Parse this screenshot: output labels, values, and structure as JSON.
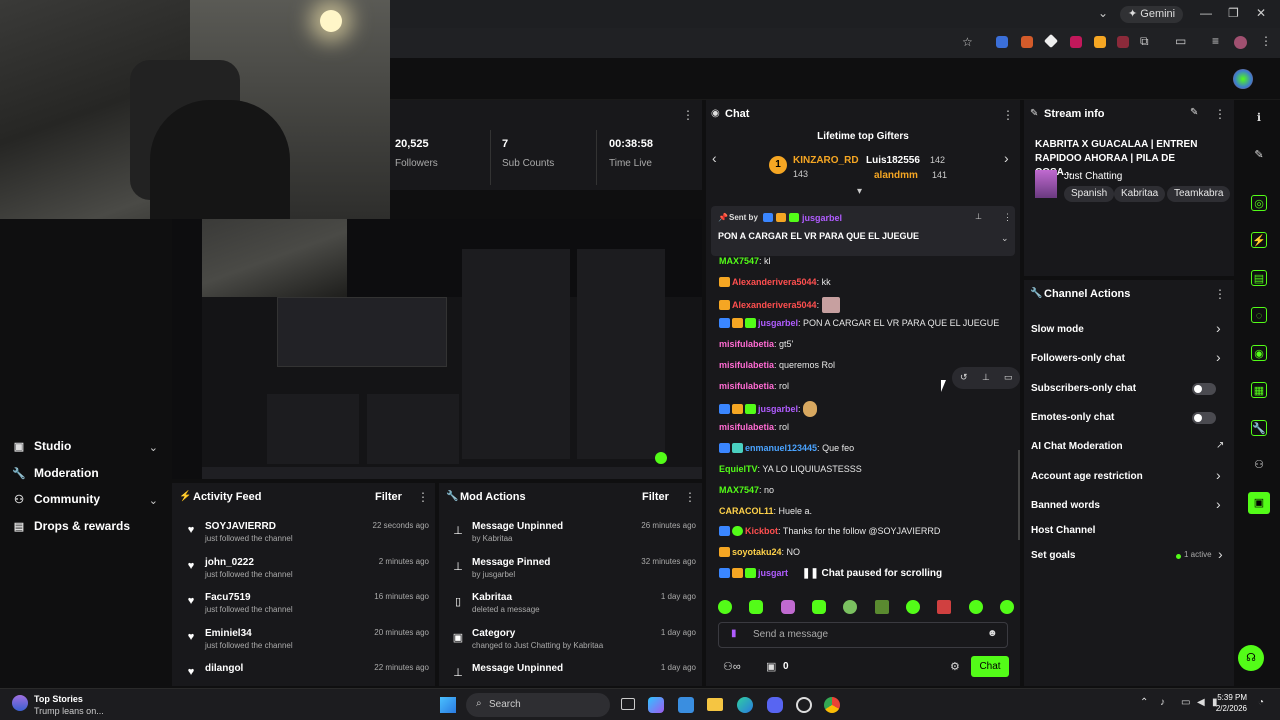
{
  "browser": {
    "gemini_label": "Gemini",
    "window_controls": [
      "⌄",
      "—",
      "❐",
      "✕"
    ]
  },
  "stats": {
    "followers_value": "20,525",
    "followers_label": "Followers",
    "subs_value": "7",
    "subs_label": "Sub Counts",
    "time_value": "00:38:58",
    "time_label": "Time Live"
  },
  "sidebar": {
    "items": [
      {
        "label": "Studio",
        "icon": "studio-icon"
      },
      {
        "label": "Moderation",
        "icon": "wrench-icon"
      },
      {
        "label": "Community",
        "icon": "community-icon"
      },
      {
        "label": "Drops & rewards",
        "icon": "drops-icon"
      }
    ]
  },
  "chat": {
    "title": "Chat",
    "gifters_title": "Lifetime top Gifters",
    "gifters": [
      {
        "rank": "1",
        "name": "KINZARO_RD",
        "count": "143"
      },
      {
        "name": "Luis182556",
        "count": "142"
      },
      {
        "name": "alandmm",
        "count": "141"
      }
    ],
    "pinned": {
      "sent_by_label": "Sent by",
      "user": "jusgarbel",
      "text": "PON A CARGAR EL VR PARA QUE EL JUEGUE"
    },
    "messages": [
      {
        "user": "MAX7547",
        "color": "#53fc18",
        "text": "kl"
      },
      {
        "user": "Alexanderivera5044",
        "color": "#ff4f4f",
        "text": "kk"
      },
      {
        "user": "Alexanderivera5044",
        "color": "#ff4f4f",
        "text": ""
      },
      {
        "user": "jusgarbel",
        "color": "#b05cff",
        "text": "PON A CARGAR EL VR PARA QUE EL JUEGUE"
      },
      {
        "user": "misifulabetia",
        "color": "#ff6bd3",
        "text": "gt5'"
      },
      {
        "user": "misifulabetia",
        "color": "#ff6bd3",
        "text": "queremos Rol"
      },
      {
        "user": "misifulabetia",
        "color": "#ff6bd3",
        "text": "rol"
      },
      {
        "user": "jusgarbel",
        "color": "#b05cff",
        "text": ""
      },
      {
        "user": "misifulabetia",
        "color": "#ff6bd3",
        "text": "rol"
      },
      {
        "user": "enmanuel123445",
        "color": "#4aa3ff",
        "text": "Que feo"
      },
      {
        "user": "EquielTV",
        "color": "#53fc18",
        "text": "YA LO LIQUIUASTESSS"
      },
      {
        "user": "MAX7547",
        "color": "#53fc18",
        "text": "no"
      },
      {
        "user": "CARACOL11",
        "color": "#ffd24a",
        "text": "Huele a."
      },
      {
        "user": "Kickbot",
        "color": "#ff4f4f",
        "text": "Thanks for the follow @SOYJAVIERRD"
      },
      {
        "user": "soyotaku24",
        "color": "#ffd24a",
        "text": "NO"
      },
      {
        "user": "jusgart",
        "color": "#b05cff",
        "text": ""
      }
    ],
    "paused_label": "Chat paused for scrolling",
    "input_placeholder": "Send a message",
    "viewer_count": "0",
    "chat_button": "Chat"
  },
  "stream_info": {
    "title": "Stream info",
    "stream_title": "KABRITA X GUACALAA | ENTREN RAPIDOO AHORAA | PILA DE COSA...",
    "category": "Just Chatting",
    "tags": [
      "Spanish",
      "Kabritaa",
      "Teamkabra"
    ]
  },
  "channel_actions": {
    "title": "Channel Actions",
    "items": [
      {
        "label": "Slow mode",
        "control": "chevron"
      },
      {
        "label": "Followers-only chat",
        "control": "chevron"
      },
      {
        "label": "Subscribers-only chat",
        "control": "toggle"
      },
      {
        "label": "Emotes-only chat",
        "control": "toggle"
      },
      {
        "label": "AI Chat Moderation",
        "control": "external"
      },
      {
        "label": "Account age restriction",
        "control": "chevron"
      },
      {
        "label": "Banned words",
        "control": "chevron"
      },
      {
        "label": "Host Channel",
        "control": "none"
      },
      {
        "label": "Set goals",
        "control": "chevron"
      }
    ],
    "goals_active": "1 active"
  },
  "activity_feed": {
    "title": "Activity Feed",
    "filter_label": "Filter",
    "items": [
      {
        "user": "SOYJAVIERRD",
        "action": "just followed the channel",
        "time": "22 seconds ago"
      },
      {
        "user": "john_0222",
        "action": "just followed the channel",
        "time": "2 minutes ago"
      },
      {
        "user": "Facu7519",
        "action": "just followed the channel",
        "time": "16 minutes ago"
      },
      {
        "user": "Eminiel34",
        "action": "just followed the channel",
        "time": "20 minutes ago"
      },
      {
        "user": "dilangol",
        "action": "just followed the channel",
        "time": "22 minutes ago"
      }
    ]
  },
  "mod_actions": {
    "title": "Mod Actions",
    "filter_label": "Filter",
    "items": [
      {
        "title": "Message Unpinned",
        "detail": "by Kabritaa",
        "time": "26 minutes ago",
        "icon": "unpin-icon"
      },
      {
        "title": "Message Pinned",
        "detail": "by jusgarbel",
        "time": "32 minutes ago",
        "icon": "pin-icon"
      },
      {
        "title": "Kabritaa",
        "detail": "deleted a message",
        "time": "1 day ago",
        "icon": "trash-icon"
      },
      {
        "title": "Category",
        "detail": "changed to Just Chatting by Kabritaa",
        "time": "1 day ago",
        "icon": "category-icon"
      },
      {
        "title": "Message Unpinned",
        "detail": "",
        "time": "1 day ago",
        "icon": "unpin-icon"
      }
    ]
  },
  "taskbar": {
    "news_title": "Top Stories",
    "news_sub": "Trump leans on...",
    "search_label": "Search",
    "time": "5:39 PM",
    "date": "2/2/2026"
  },
  "colors": {
    "accent": "#53fc18",
    "panel": "#18181b",
    "background": "#0f0f10"
  }
}
